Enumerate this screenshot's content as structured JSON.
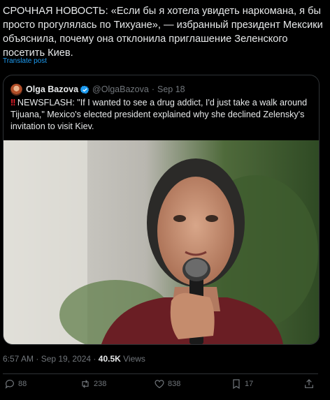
{
  "post": {
    "text": "СРОЧНАЯ НОВОСТЬ: «Если бы я хотела увидеть наркомана, я бы просто прогулялась по Тихуане», — избранный президент Мексики объяснила, почему она отклонила приглашение Зеленского посетить Киев.",
    "translate_label": "Translate post"
  },
  "quote": {
    "name": "Olga Bazova",
    "handle": "@OlgaBazova",
    "separator": "·",
    "date": "Sep 18",
    "alert_icon": "!!",
    "text": "NEWSFLASH: \"If I wanted to see a drug addict, I'd just take a walk around Tijuana,\" Mexico's elected president explained why she declined Zelensky's invitation to visit Kiev."
  },
  "meta": {
    "time": "6:57 AM · Sep 19, 2024 · ",
    "views_count": "40.5K",
    "views_label": " Views"
  },
  "actions": {
    "replies": "88",
    "reposts": "238",
    "likes": "838",
    "bookmarks": "17"
  },
  "colors": {
    "background": "#000000",
    "text": "#e7e9ea",
    "muted": "#71767b",
    "link": "#1d9bf0",
    "border": "#2f3336",
    "alert": "#f4212e"
  }
}
